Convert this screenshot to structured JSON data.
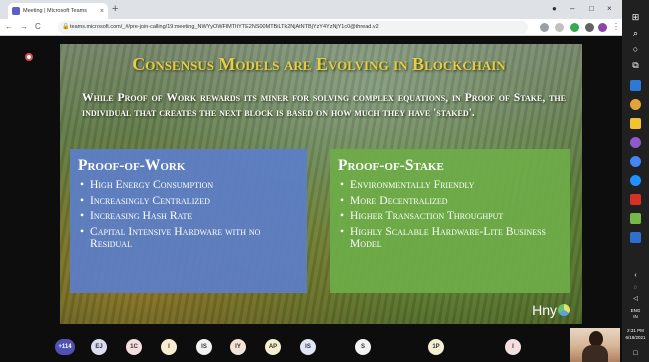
{
  "browser": {
    "tab_title": "Meeting | Microsoft Teams",
    "tab_close": "×",
    "new_tab": "+",
    "url": "teams.microsoft.com/_#/pre-join-calling/19:meeting_NWYyOWFlMTItYTE2NS00MTBiLTk2NjAtNTBjYzY4YzNjY1c0@thread.v2",
    "nav_back": "←",
    "nav_forward": "→",
    "nav_reload": "C",
    "win_min": "–",
    "win_max": "□",
    "win_close": "×"
  },
  "slide": {
    "title": "Consensus Models are Evolving in Blockchain",
    "subtitle": "While Proof of Work rewards its miner for solving complex equations, in Proof of Stake, the individual that creates the next block is based on how much they have 'staked'.",
    "pow": {
      "title": "Proof-of-Work",
      "items": [
        "High Energy Consumption",
        "Increasingly Centralized",
        "Increasing Hash Rate",
        "Capital Intensive Hardware with no Residual"
      ]
    },
    "pos": {
      "title": "Proof-of-Stake",
      "items": [
        "Environmentally Friendly",
        "More Decentralized",
        "Higher Transaction Throughput",
        "Highly Scalable Hardware-Lite Business Model"
      ]
    },
    "brand": "Hny"
  },
  "participants": {
    "count_badge": "+114",
    "avatars": [
      {
        "initials": "EJ",
        "color": "#dcdcf0"
      },
      {
        "initials": "1C",
        "color": "#f5dede"
      },
      {
        "initials": "I",
        "color": "#f7ecd0"
      },
      {
        "initials": "IS",
        "color": "#f2f2f2"
      },
      {
        "initials": "IY",
        "color": "#f3e3d6"
      },
      {
        "initials": "AP",
        "color": "#f5efd2"
      },
      {
        "initials": "IS",
        "color": "#e0e6f5"
      },
      {
        "initials": "S",
        "color": "#f2f2f2"
      },
      {
        "initials": "1P",
        "color": "#f5efd2"
      },
      {
        "initials": "I",
        "color": "#f5dede"
      }
    ]
  },
  "taskbar": {
    "lang": "ENG",
    "region": "IN",
    "time": "2:31 PM",
    "date": "6/18/2021"
  }
}
